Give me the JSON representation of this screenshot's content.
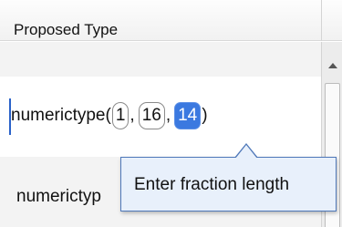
{
  "header": {
    "column_title": "Proposed Type"
  },
  "rows": {
    "edit_row": {
      "prefix": "numerictype(",
      "arg1": "1",
      "arg2": "16",
      "arg3": "14",
      "separator": ",",
      "suffix": ")"
    },
    "bottom_row": {
      "text": "numerictyp"
    }
  },
  "tooltip": {
    "text": "Enter fraction length"
  },
  "scrollbar": {
    "up_icon": "triangle-up"
  },
  "colors": {
    "selection": "#3b79e0",
    "tooltip_bg": "#e8f0fb",
    "tooltip_border": "#4f78b9",
    "caret": "#2a62c9"
  }
}
